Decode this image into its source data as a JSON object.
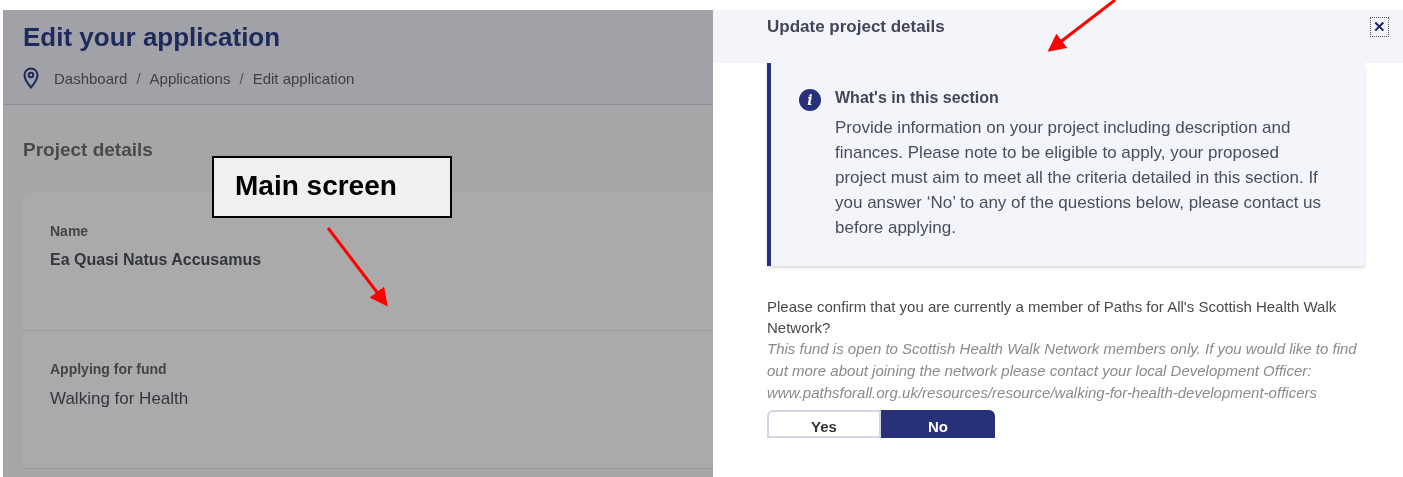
{
  "main": {
    "title": "Edit your application",
    "breadcrumb": [
      "Dashboard",
      "Applications",
      "Edit application"
    ],
    "breadcrumb_separator": "/",
    "section_title": "Project details",
    "fields": [
      {
        "label": "Name",
        "value": "Ea Quasi Natus Accusamus",
        "kind": "bold"
      },
      {
        "label": "Applying for fund",
        "value": "Walking for Health",
        "kind": "plain"
      }
    ]
  },
  "annotation": {
    "callout": "Main screen"
  },
  "panel": {
    "title": "Update project details",
    "close": "✕",
    "info": {
      "title": "What's in this section",
      "icon": "i",
      "text": "Provide information on your project including description and finances. Please note to be eligible to apply, your proposed project must aim to meet all the criteria detailed in this section. If you answer ‘No’ to any of the questions below, please contact us before applying."
    },
    "question": "Please confirm that you are currently a member of Paths for All's Scottish Health Walk Network?",
    "hint": "This fund is open to Scottish Health Walk Network members only. If you would like to find out more about joining the network please contact your local Development Officer: www.pathsforall.org.uk/resources/resource/walking-for-health-development-officers",
    "options": [
      {
        "label": "Yes",
        "selected": false
      },
      {
        "label": "No",
        "selected": true
      }
    ]
  }
}
